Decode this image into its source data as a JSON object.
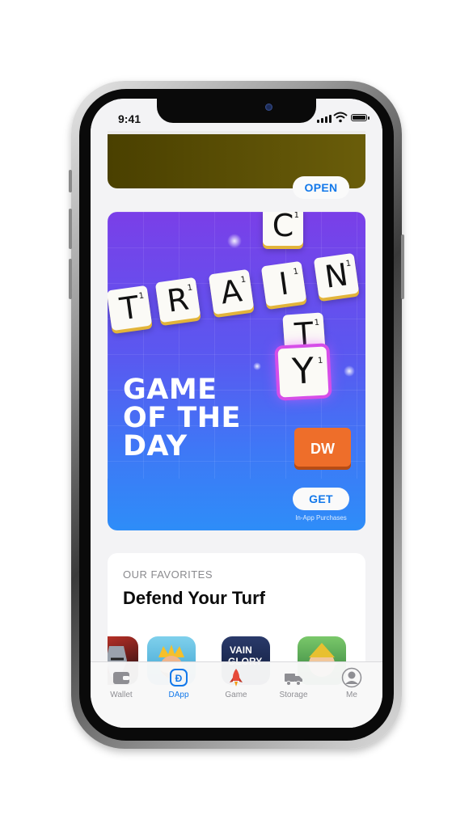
{
  "status_bar": {
    "time": "9:41"
  },
  "top_card": {
    "button_label": "OPEN"
  },
  "featured": {
    "banner_line1": "GAME",
    "banner_line2": "OF THE",
    "banner_line3": "DAY",
    "tiles_row": [
      "T",
      "R",
      "A",
      "I",
      "N"
    ],
    "tiles_col": [
      "C",
      "T",
      "Y"
    ],
    "tile_score": "1",
    "badge": "DW",
    "button_label": "GET",
    "button_note": "In-App Purchases"
  },
  "favorites": {
    "eyebrow": "OUR FAVORITES",
    "title": "Defend Your Turf",
    "icon_texts": [
      "VAIN",
      "GLORY"
    ]
  },
  "tabs": [
    {
      "label": "Wallet",
      "icon": "wallet-icon"
    },
    {
      "label": "DApp",
      "icon": "dapp-icon"
    },
    {
      "label": "Game",
      "icon": "rocket-icon"
    },
    {
      "label": "Storage",
      "icon": "truck-icon"
    },
    {
      "label": "Me",
      "icon": "profile-icon"
    }
  ],
  "colors": {
    "accent": "#1278ea",
    "tab_inactive": "#8e8e93",
    "featured_top": "#7a3fe8",
    "featured_bottom": "#2e8df8",
    "top_card": "#5a4f05",
    "dw_badge": "#ee6e2a"
  }
}
